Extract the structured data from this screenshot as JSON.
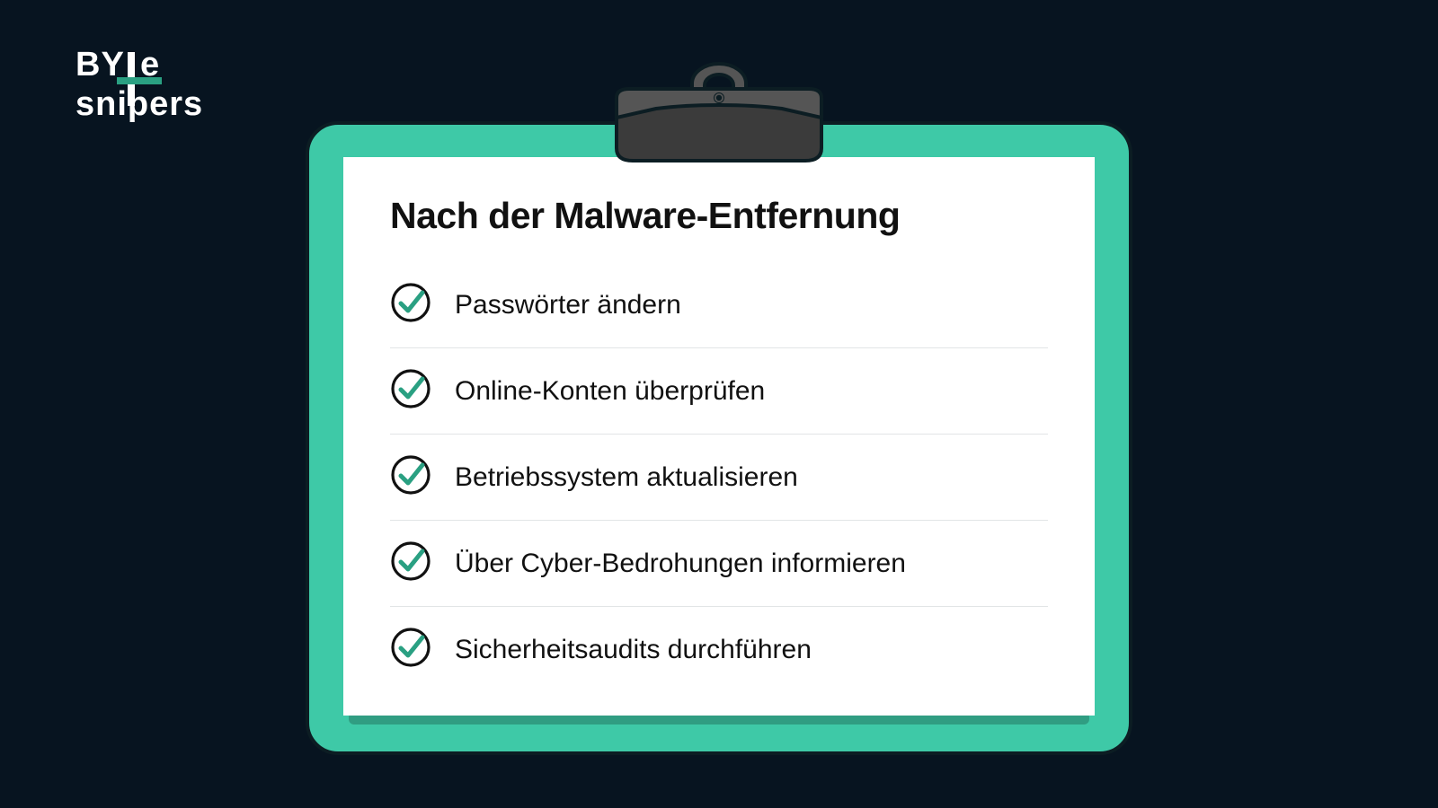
{
  "logo": {
    "text_top": "BYTE",
    "text_bottom": "SNIPERS"
  },
  "checklist": {
    "title": "Nach der Malware-Entfernung",
    "items": [
      {
        "label": "Passwörter ändern"
      },
      {
        "label": "Online-Konten überprüfen"
      },
      {
        "label": "Betriebssystem aktualisieren"
      },
      {
        "label": "Über Cyber-Bedrohungen informieren"
      },
      {
        "label": "Sicherheitsaudits durchführen"
      }
    ]
  },
  "colors": {
    "background": "#071420",
    "board": "#3ec9a7",
    "accent": "#2aa082",
    "clip_dark": "#3b3b3b",
    "clip_light": "#555"
  }
}
